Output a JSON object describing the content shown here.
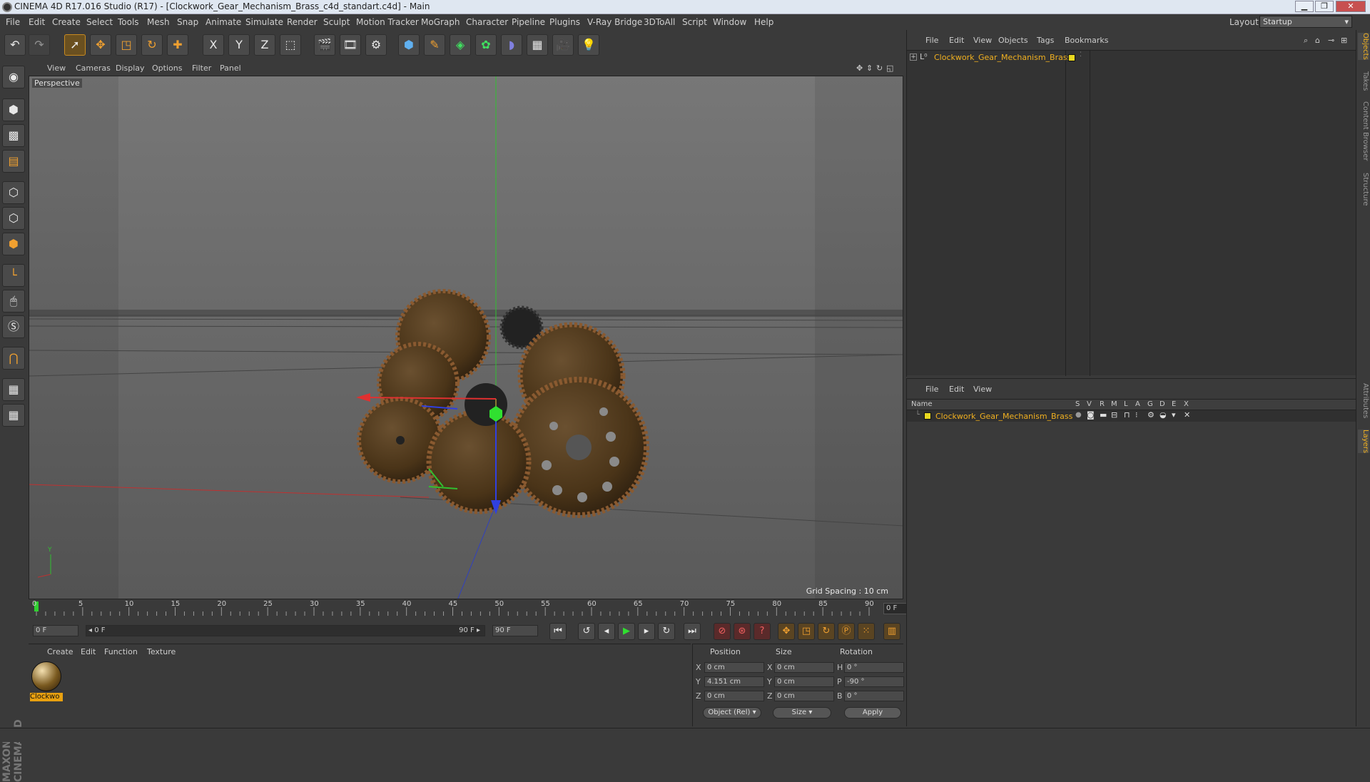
{
  "window": {
    "title": "CINEMA 4D R17.016 Studio (R17) - [Clockwork_Gear_Mechanism_Brass_c4d_standart.c4d] - Main",
    "buttons": [
      "▁",
      "❐",
      "✕"
    ]
  },
  "menubar": {
    "items": [
      "File",
      "Edit",
      "Create",
      "Select",
      "Tools",
      "Mesh",
      "Snap",
      "Animate",
      "Simulate",
      "Render",
      "Sculpt",
      "Motion Tracker",
      "MoGraph",
      "Character",
      "Pipeline",
      "Plugins",
      "V-Ray Bridge",
      "3DToAll",
      "Script",
      "Window",
      "Help"
    ],
    "layout_label": "Layout:",
    "layout_value": "Startup"
  },
  "toolbar": {
    "axis_x": "X",
    "axis_y": "Y",
    "axis_z": "Z"
  },
  "viewport": {
    "menu": [
      "View",
      "Cameras",
      "Display",
      "Options",
      "Filter",
      "Panel"
    ],
    "label": "Perspective",
    "grid_spacing": "Grid Spacing : 10 cm"
  },
  "timeline": {
    "ticks": [
      "0",
      "5",
      "10",
      "15",
      "20",
      "25",
      "30",
      "35",
      "40",
      "45",
      "50",
      "55",
      "60",
      "65",
      "70",
      "75",
      "80",
      "85",
      "90"
    ],
    "current_frame": "0 F"
  },
  "transport": {
    "start_field": "0 F",
    "range_start": "◂ 0 F",
    "range_end": "90 F ▸",
    "end_field": "90 F"
  },
  "material_panel": {
    "menu": [
      "Create",
      "Edit",
      "Function",
      "Texture"
    ],
    "material_label": "Clockwo"
  },
  "coordinates": {
    "headers": [
      "Position",
      "Size",
      "Rotation"
    ],
    "rows": [
      {
        "axis": "X",
        "pos": "0 cm",
        "size_axis": "X",
        "size": "0 cm",
        "rot_axis": "H",
        "rot": "0 °"
      },
      {
        "axis": "Y",
        "pos": "4.151 cm",
        "size_axis": "Y",
        "size": "0 cm",
        "rot_axis": "P",
        "rot": "-90 °"
      },
      {
        "axis": "Z",
        "pos": "0 cm",
        "size_axis": "Z",
        "size": "0 cm",
        "rot_axis": "B",
        "rot": "0 °"
      }
    ],
    "mode_select": "Object (Rel)",
    "size_select": "Size",
    "apply_label": "Apply"
  },
  "object_manager": {
    "menu": [
      "File",
      "Edit",
      "View",
      "Objects",
      "Tags",
      "Bookmarks"
    ],
    "objects": [
      {
        "name": "Clockwork_Gear_Mechanism_Brass"
      }
    ]
  },
  "layer_manager": {
    "menu": [
      "File",
      "Edit",
      "View"
    ],
    "columns": [
      "Name",
      "S",
      "V",
      "R",
      "M",
      "L",
      "A",
      "G",
      "D",
      "E",
      "X"
    ],
    "layers": [
      {
        "name": "Clockwork_Gear_Mechanism_Brass"
      }
    ]
  },
  "side_tabs": [
    "Objects",
    "Takes",
    "Content Browser",
    "Structure",
    "Attributes",
    "Layers"
  ],
  "branding": "MAXON CINEMA 4D",
  "colors": {
    "accent": "#f0b020",
    "axis_x": "#e03030",
    "axis_y": "#30c030",
    "axis_z": "#3040e0"
  }
}
